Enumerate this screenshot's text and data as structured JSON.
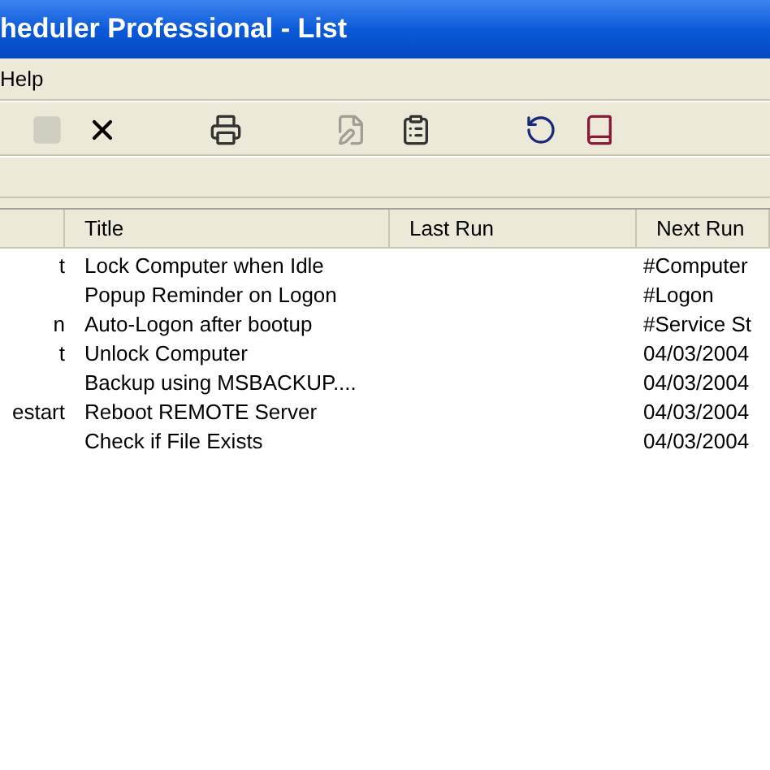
{
  "window": {
    "title": "heduler Professional - List"
  },
  "menu": [
    "Help"
  ],
  "toolbar": [
    {
      "kind": "stop",
      "disabled": true
    },
    {
      "kind": "delete",
      "disabled": false
    },
    {
      "kind": "print",
      "disabled": false
    },
    {
      "kind": "edit",
      "disabled": true
    },
    {
      "kind": "properties",
      "disabled": false
    },
    {
      "kind": "refresh",
      "disabled": false
    },
    {
      "kind": "help",
      "disabled": false
    }
  ],
  "table": {
    "columns": [
      "Title",
      "Last Run",
      "Next Run"
    ],
    "rows": [
      {
        "column_1": "t",
        "title": "Lock Computer when Idle",
        "next_run": "#Computer"
      },
      {
        "title": "Popup Reminder on Logon",
        "next_run": "#Logon"
      },
      {
        "column_1": "n",
        "title": "Auto-Logon after bootup",
        "next_run": "#Service St"
      },
      {
        "column_1": "t",
        "title": "Unlock Computer",
        "next_run": "04/03/2004"
      },
      {
        "title": "Backup using MSBACKUP....",
        "next_run": "04/03/2004"
      },
      {
        "column_1": "estart",
        "title": "Reboot REMOTE Server",
        "next_run": "04/03/2004"
      },
      {
        "title": "Check if File Exists",
        "next_run": "04/03/2004"
      }
    ]
  }
}
